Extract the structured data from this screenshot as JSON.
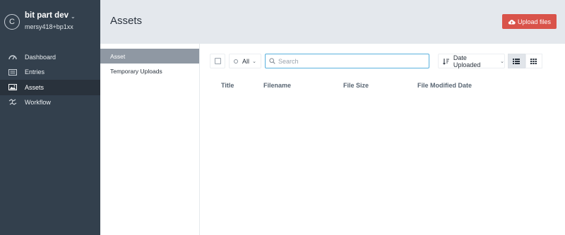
{
  "site": {
    "logo_letter": "C",
    "name": "bit part dev",
    "user": "mersy418+bp1xx"
  },
  "nav": {
    "items": [
      {
        "label": "Dashboard",
        "icon": "dashboard-icon",
        "active": false
      },
      {
        "label": "Entries",
        "icon": "entries-icon",
        "active": false
      },
      {
        "label": "Assets",
        "icon": "image-icon",
        "active": true
      },
      {
        "label": "Workflow",
        "icon": "workflow-icon",
        "active": false
      }
    ]
  },
  "header": {
    "title": "Assets",
    "upload_label": "Upload files"
  },
  "sources": {
    "items": [
      {
        "label": "Asset",
        "active": true
      },
      {
        "label": "Temporary Uploads",
        "active": false
      }
    ]
  },
  "toolbar": {
    "status_label": "All",
    "search_placeholder": "Search",
    "sort_label": "Date Uploaded",
    "view_modes": [
      "list-view-icon",
      "grid-view-icon"
    ],
    "active_view": "list-view-icon"
  },
  "table": {
    "columns": [
      "Title",
      "Filename",
      "File Size",
      "File Modified Date"
    ]
  },
  "colors": {
    "sidebar": "#33404d",
    "header": "#e4e8ed",
    "upload_button": "#d9534a",
    "search_focus": "#5ab1de"
  }
}
